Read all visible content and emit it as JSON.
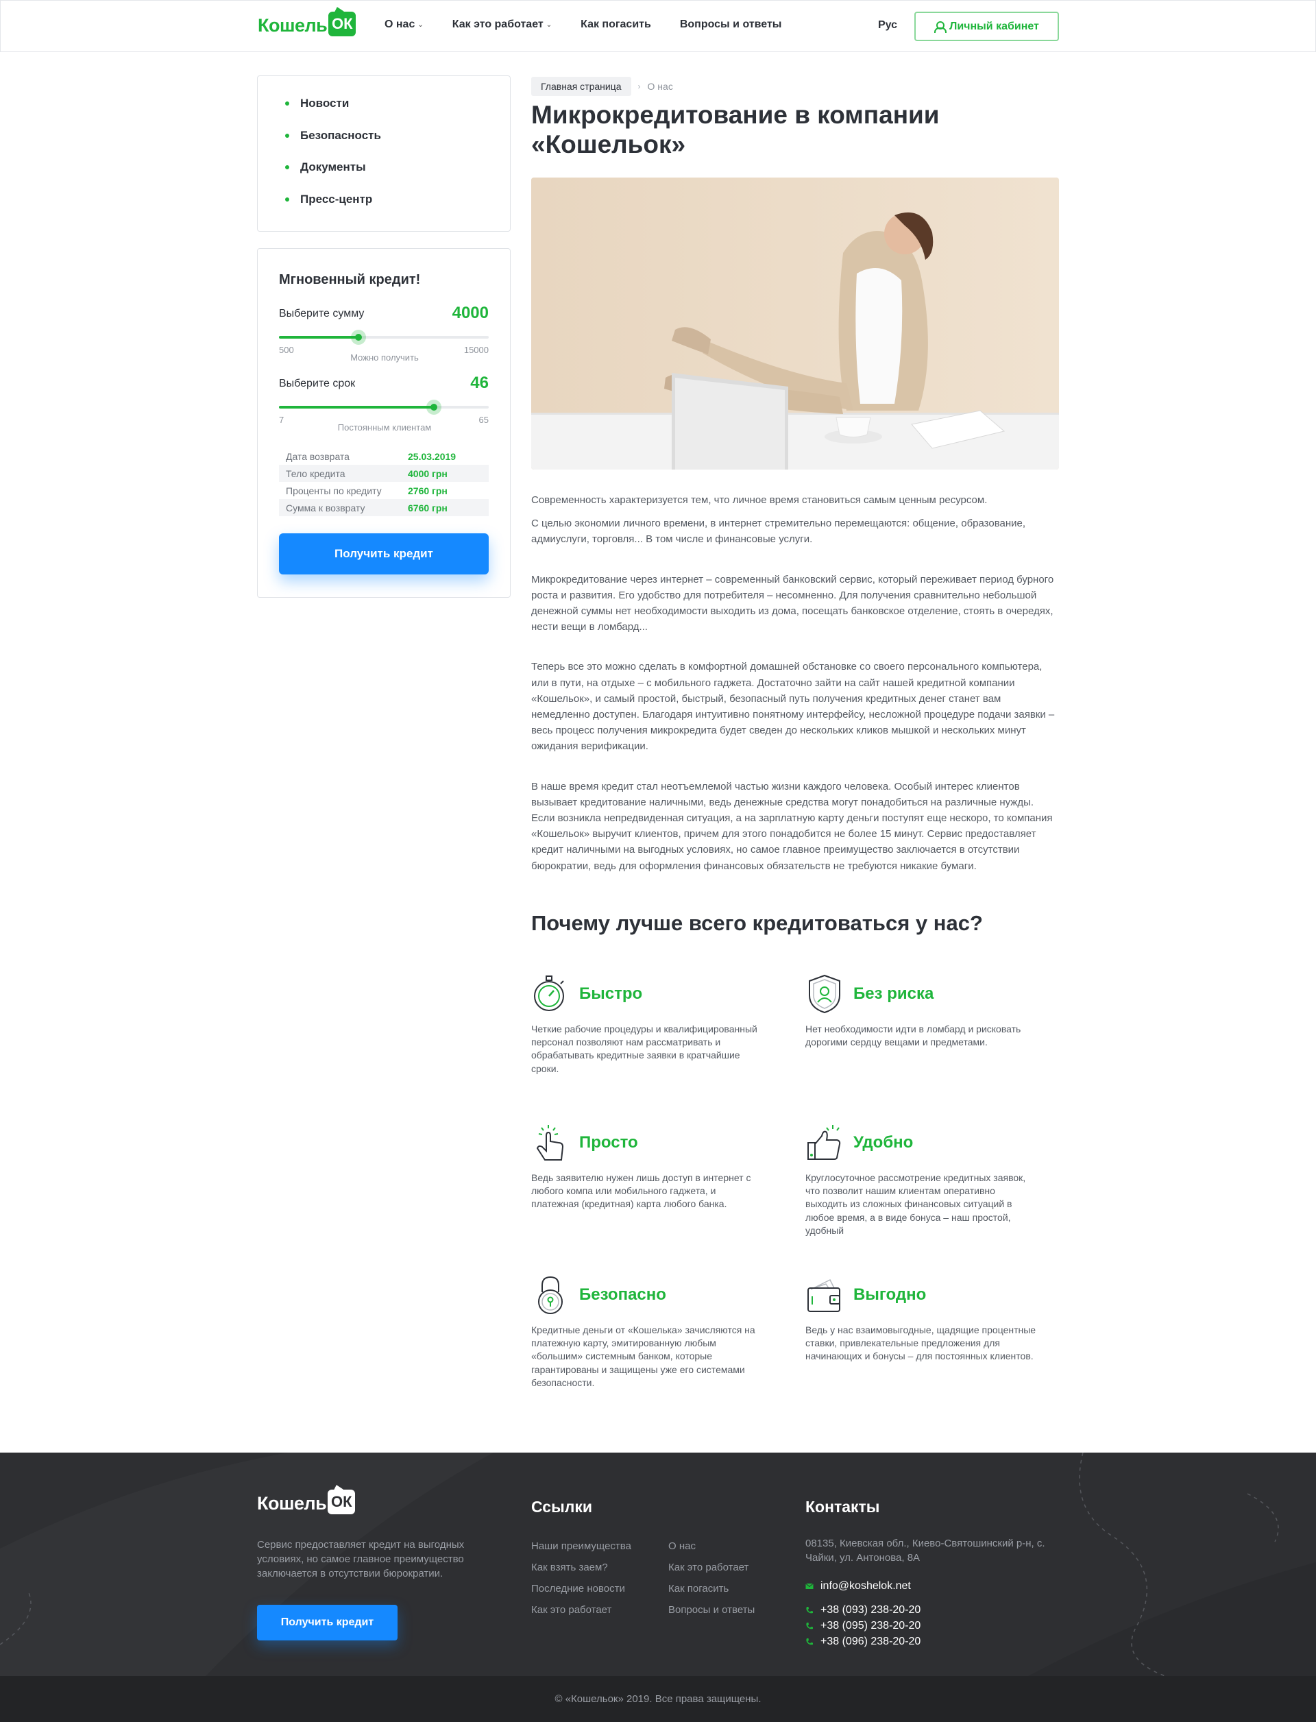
{
  "header": {
    "logo_text": "Кошель",
    "logo_badge": "ОК",
    "nav": [
      {
        "label": "О нас",
        "has_dropdown": true
      },
      {
        "label": "Как это работает",
        "has_dropdown": true
      },
      {
        "label": "Как погасить",
        "has_dropdown": false
      },
      {
        "label": "Вопросы и ответы",
        "has_dropdown": false
      }
    ],
    "language": "Рус",
    "cabinet_label": "Личный кабинет"
  },
  "sidebar": {
    "menu": [
      "Новости",
      "Безопасность",
      "Документы",
      "Пресс-центр"
    ],
    "calculator": {
      "title": "Мгновенный кредит!",
      "amount_label": "Выберите сумму",
      "amount_value": "4000",
      "amount_min": "500",
      "amount_max": "15000",
      "amount_fraction": 0.38,
      "amount_hint": "Можно получить",
      "term_label": "Выберите срок",
      "term_value": "46",
      "term_min": "7",
      "term_max": "65",
      "term_fraction": 0.74,
      "term_hint": "Постоянным клиентам",
      "summary": [
        {
          "key": "Дата возврата",
          "value": "25.03.2019"
        },
        {
          "key": "Тело кредита",
          "value": "4000 грн"
        },
        {
          "key": "Проценты по кредиту",
          "value": "2760 грн"
        },
        {
          "key": "Сумма к возврату",
          "value": "6760 грн"
        }
      ],
      "button_label": "Получить кредит"
    }
  },
  "main": {
    "breadcrumb": {
      "home": "Главная страница",
      "separator": "›",
      "current": "О нас"
    },
    "title": "Микрокредитование в компании «Кошельок»",
    "paragraphs": [
      "Современность характеризуется тем, что личное время становиться самым ценным ресурсом.",
      "С целью экономии личного времени, в интернет стремительно перемещаются: общение, образование, адмиуслуги, торговля... В том числе и финансовые услуги.",
      "Микрокредитование через интернет – современный банковский сервис, который переживает период бурного роста и развития. Его удобство для потребителя – несомненно. Для получения сравнительно небольшой денежной суммы нет необходимости выходить из дома, посещать банковское отделение, стоять в очередях, нести вещи в ломбард...",
      "Теперь все это можно сделать в комфортной домашней обстановке со своего персонального компьютера, или в пути, на отдыхе – с мобильного гаджета. Достаточно зайти на сайт нашей кредитной компании «Кошельок», и самый простой, быстрый, безопасный путь получения кредитных денег станет вам немедленно доступен. Благодаря интуитивно понятному интерфейсу, несложной процедуре подачи заявки – весь процесс получения микрокредита будет сведен до нескольких кликов мышкой и нескольких минут ожидания верификации.",
      "В наше время кредит стал неотъемлемой частью жизни каждого человека. Особый интерес клиентов вызывает кредитование наличными, ведь денежные средства могут понадобиться на различные нужды. Если возникла непредвиденная ситуация, а на зарплатную карту деньги поступят еще нескоро, то компания «Кошельок» выручит клиентов, причем для этого понадобится не более 15 минут. Сервис предоставляет кредит наличными на выгодных условиях, но самое главное преимущество заключается в отсутствии бюрократии, ведь для оформления финансовых обязательств не требуются никакие бумаги."
    ],
    "why_title": "Почему лучше всего кредитоваться у нас?",
    "features": [
      {
        "icon": "stopwatch-icon",
        "title": "Быстро",
        "text": "Четкие рабочие процедуры и квалифицированный персонал позволяют нам рассматривать и обрабатывать кредитные заявки в кратчайшие сроки."
      },
      {
        "icon": "shield-user-icon",
        "title": "Без риска",
        "text": "Нет необходимости идти в ломбард и рисковать дорогими сердцу вещами и предметами."
      },
      {
        "icon": "tap-hand-icon",
        "title": "Просто",
        "text": "Ведь заявителю нужен лишь доступ в интернет с любого компа или мобильного гаджета, и платежная (кредитная) карта любого банка."
      },
      {
        "icon": "thumbs-up-icon",
        "title": "Удобно",
        "text": "Круглосуточное рассмотрение кредитных заявок, что позволит нашим клиентам оперативно выходить из сложных финансовых ситуаций в любое время, а в виде бонуса – наш простой, удобный"
      },
      {
        "icon": "padlock-icon",
        "title": "Безопасно",
        "text": "Кредитные деньги от «Кошелька» зачисляются на платежную карту, эмитированную любым «большим» системным банком, которые гарантированы и защищены уже его системами безопасности."
      },
      {
        "icon": "wallet-icon",
        "title": "Выгодно",
        "text": "Ведь у нас взаимовыгодные, щадящие процентные ставки, привлекательные предложения для начинающих и бонусы – для постоянных клиентов."
      }
    ]
  },
  "footer": {
    "logo_text": "Кошель",
    "logo_badge": "ОК",
    "about": "Сервис предоставляет кредит на выгодных условиях, но самое главное преимущество заключается в отсутствии бюрократии.",
    "button_label": "Получить кредит",
    "links_title": "Ссылки",
    "links_col1": [
      "Наши преимущества",
      "Как взять заем?",
      "Последние новости",
      "Как это работает"
    ],
    "links_col2": [
      "О нас",
      "Как это работает",
      "Как погасить",
      "Вопросы и ответы"
    ],
    "contacts_title": "Контакты",
    "address": "08135, Киевская обл., Киево-Святошинский р-н, с. Чайки, ул. Антонова, 8А",
    "email": "info@koshelok.net",
    "phones": [
      "+38 (093) 238-20-20",
      "+38 (095) 238-20-20",
      "+38 (096) 238-20-20"
    ],
    "copyright": "© «Кошельок» 2019. Все права защищены."
  },
  "colors": {
    "brand_green": "#1fb53b",
    "accent_blue": "#1589ff",
    "footer_bg": "#2e2f32"
  }
}
